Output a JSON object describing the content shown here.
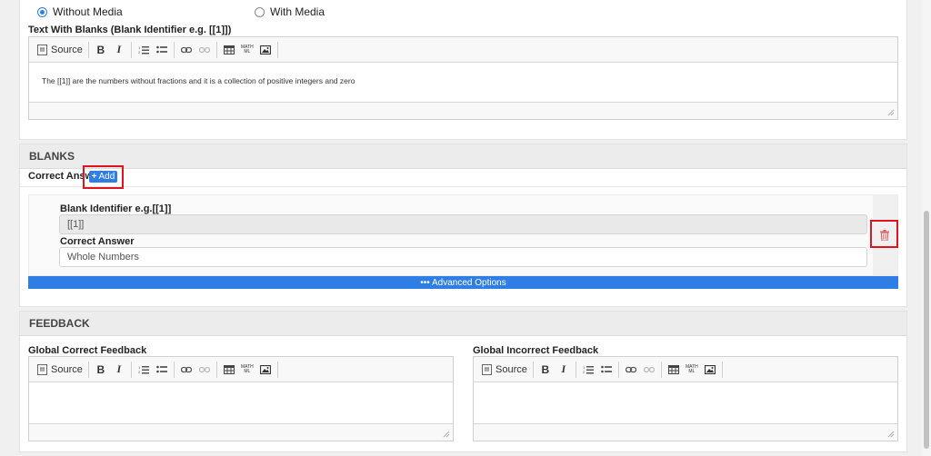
{
  "question_type": {
    "options": [
      {
        "label": "Without Media",
        "checked": true
      },
      {
        "label": "With Media",
        "checked": false
      }
    ]
  },
  "text_with_blanks": {
    "label": "Text With Blanks (Blank Identifier e.g. [[1]])",
    "content": "The [[1]] are the numbers without fractions and it is a collection of positive integers and zero"
  },
  "toolbar": {
    "source_label": "Source",
    "bold_label": "B",
    "italic_label": "I",
    "mathml_label_top": "MATH",
    "mathml_label_bottom": "ML"
  },
  "blanks": {
    "header": "BLANKS",
    "correct_answer_label": "Correct Answer",
    "add_button_label": "Add",
    "item": {
      "identifier_label": "Blank Identifier e.g.[[1]]",
      "identifier_value": "[[1]]",
      "answer_label": "Correct Answer",
      "answer_value": "Whole Numbers"
    },
    "advanced_options_label": "••• Advanced Options"
  },
  "feedback": {
    "header": "FEEDBACK",
    "correct_label": "Global Correct Feedback",
    "incorrect_label": "Global Incorrect Feedback"
  },
  "colors": {
    "accent": "#2f7ee6",
    "highlight": "#e0141e",
    "delete_icon": "#e05a5a"
  }
}
